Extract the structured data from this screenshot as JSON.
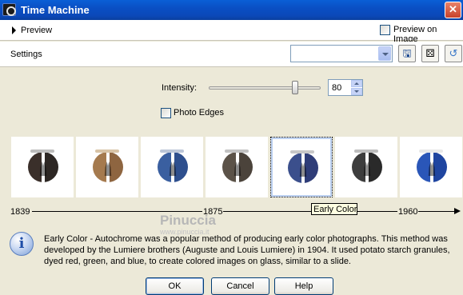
{
  "window": {
    "title": "Time Machine",
    "close_glyph": "✕"
  },
  "preview_row": {
    "preview_label": "Preview",
    "preview_on_image_label": "Preview on Image",
    "preview_on_image_checked": false
  },
  "settings_row": {
    "settings_label": "Settings",
    "preset_value": "",
    "save_icon": "save-icon",
    "random_icon": "dice-icon",
    "reset_icon": "reset-icon",
    "save_glyph": "🖫",
    "random_glyph": "⚄",
    "reset_glyph": "↺"
  },
  "controls": {
    "intensity_label": "Intensity:",
    "intensity_value": "80",
    "intensity_min": 0,
    "intensity_max": 100,
    "photo_edges_label": "Photo Edges",
    "photo_edges_checked": false
  },
  "thumbnails": [
    {
      "name": "thumb-1839",
      "left": "#3a2f2a",
      "right": "#2d2724",
      "bar": "#bdbdbd",
      "selected": false
    },
    {
      "name": "thumb-2",
      "left": "#a57a4e",
      "right": "#8e6540",
      "bar": "#d8c3a6",
      "selected": false
    },
    {
      "name": "thumb-3",
      "left": "#3a5fa0",
      "right": "#2e4f8e",
      "bar": "#bcc6d8",
      "selected": false
    },
    {
      "name": "thumb-1875",
      "left": "#5b5248",
      "right": "#4b433b",
      "bar": "#c2c2c2",
      "selected": false
    },
    {
      "name": "thumb-early-color",
      "left": "#3b4f8c",
      "right": "#2f3d78",
      "bar": "#c7c7c7",
      "selected": true
    },
    {
      "name": "thumb-6",
      "left": "#3d3d3d",
      "right": "#2a2a2a",
      "bar": "#bdbdbd",
      "selected": false
    },
    {
      "name": "thumb-7",
      "left": "#2a56b8",
      "right": "#1f45a0",
      "bar": "#e8e8e8",
      "selected": false
    }
  ],
  "timeline": {
    "year_1839": "1839",
    "year_1875": "1875",
    "year_1960": "1960"
  },
  "tooltip": "Early Color",
  "watermark": {
    "line1": "Pinuccia",
    "line2": "www.pinuccia.it"
  },
  "description": "Early Color - Autochrome was a popular method of producing early color photographs. This method was developed by the Lumiere brothers (Auguste and Louis Lumiere) in 1904. It used potato starch granules, dyed red, green, and blue, to create colored images on glass, similar to a slide.",
  "buttons": {
    "ok": "OK",
    "cancel": "Cancel",
    "help": "Help"
  },
  "colors": {
    "titlebar": "#0a4fc4",
    "dialog_bg": "#ece9d8",
    "tooltip_bg": "#ffffe1"
  }
}
